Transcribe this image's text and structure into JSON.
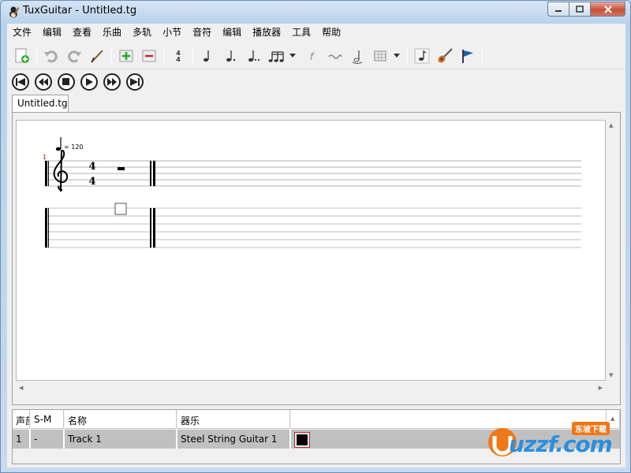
{
  "window": {
    "title": "TuxGuitar - Untitled.tg"
  },
  "menu": [
    "文件",
    "编辑",
    "查看",
    "乐曲",
    "多轨",
    "小节",
    "音符",
    "编辑",
    "播放器",
    "工具",
    "帮助"
  ],
  "tabs": [
    {
      "label": "Untitled.tg"
    }
  ],
  "score": {
    "tempo": "= 120",
    "measure_number": "1",
    "time_sig_top": "4",
    "time_sig_bottom": "4"
  },
  "tracks": {
    "headers": [
      "声部",
      "S-M",
      "名称",
      "器乐"
    ],
    "rows": [
      {
        "number": "1",
        "sm": "-",
        "name": "Track 1",
        "instrument": "Steel String Guitar 1",
        "color": "#000000"
      }
    ]
  },
  "watermark": {
    "text": "uzzf.com",
    "badge": "东坡下载"
  }
}
